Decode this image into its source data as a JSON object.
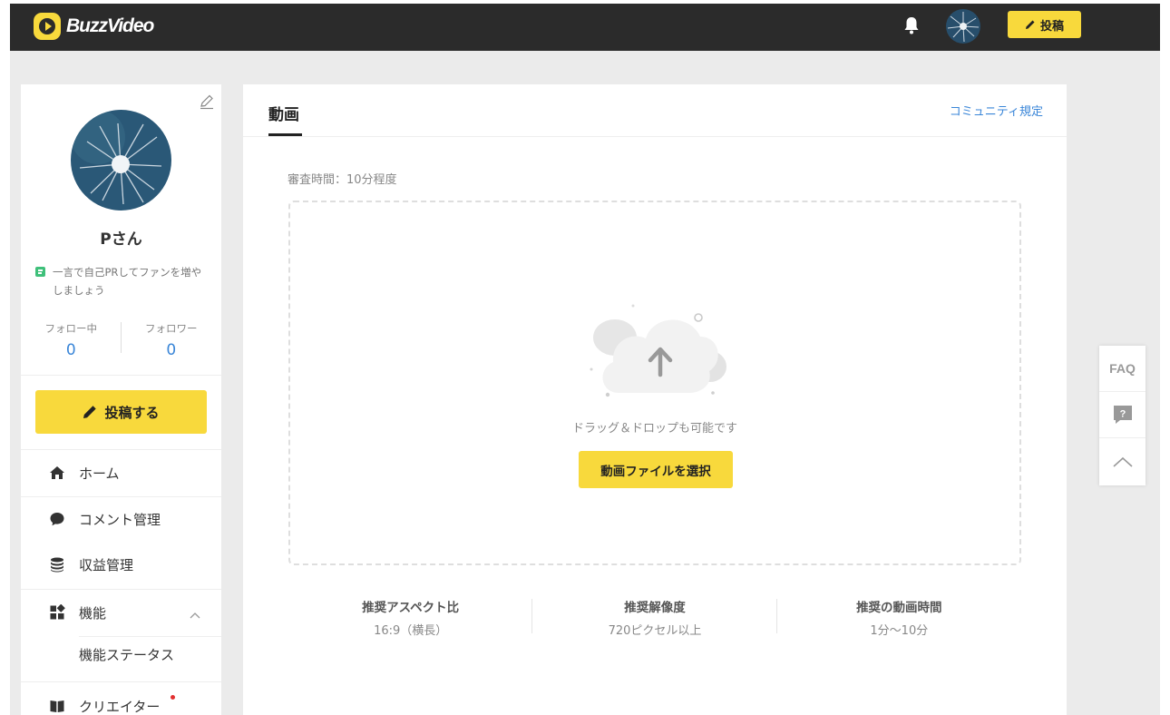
{
  "header": {
    "logo_text": "BuzzVideo",
    "post_button_label": "投稿"
  },
  "sidebar": {
    "username": "Pさん",
    "bio_placeholder": "一言で自己PRしてファンを増やしましょう",
    "following_label": "フォロー中",
    "following_count": "0",
    "followers_label": "フォロワー",
    "followers_count": "0",
    "post_button_label": "投稿する",
    "nav": [
      {
        "label": "ホーム",
        "icon": "home-icon"
      },
      {
        "label": "コメント管理",
        "icon": "comment-icon"
      },
      {
        "label": "収益管理",
        "icon": "coins-icon"
      },
      {
        "label": "機能",
        "icon": "grid-icon"
      },
      {
        "label": "クリエイター",
        "icon": "book-icon"
      }
    ],
    "sub_nav": [
      {
        "label": "機能ステータス"
      }
    ]
  },
  "main": {
    "tab_label": "動画",
    "community_link": "コミュニティ規定",
    "review_time": "審査時間：10分程度",
    "drop_text": "ドラッグ＆ドロップも可能です",
    "select_button_label": "動画ファイルを選択",
    "recommendations": [
      {
        "title": "推奨アスペクト比",
        "value": "16:9（横長）"
      },
      {
        "title": "推奨解像度",
        "value": "720ピクセル以上"
      },
      {
        "title": "推奨の動画時間",
        "value": "1分〜10分"
      }
    ]
  },
  "float_panel": {
    "faq_label": "FAQ"
  },
  "colors": {
    "accent": "#f8d93c",
    "header_bg": "#2b2b2b",
    "link": "#3a86d8"
  }
}
